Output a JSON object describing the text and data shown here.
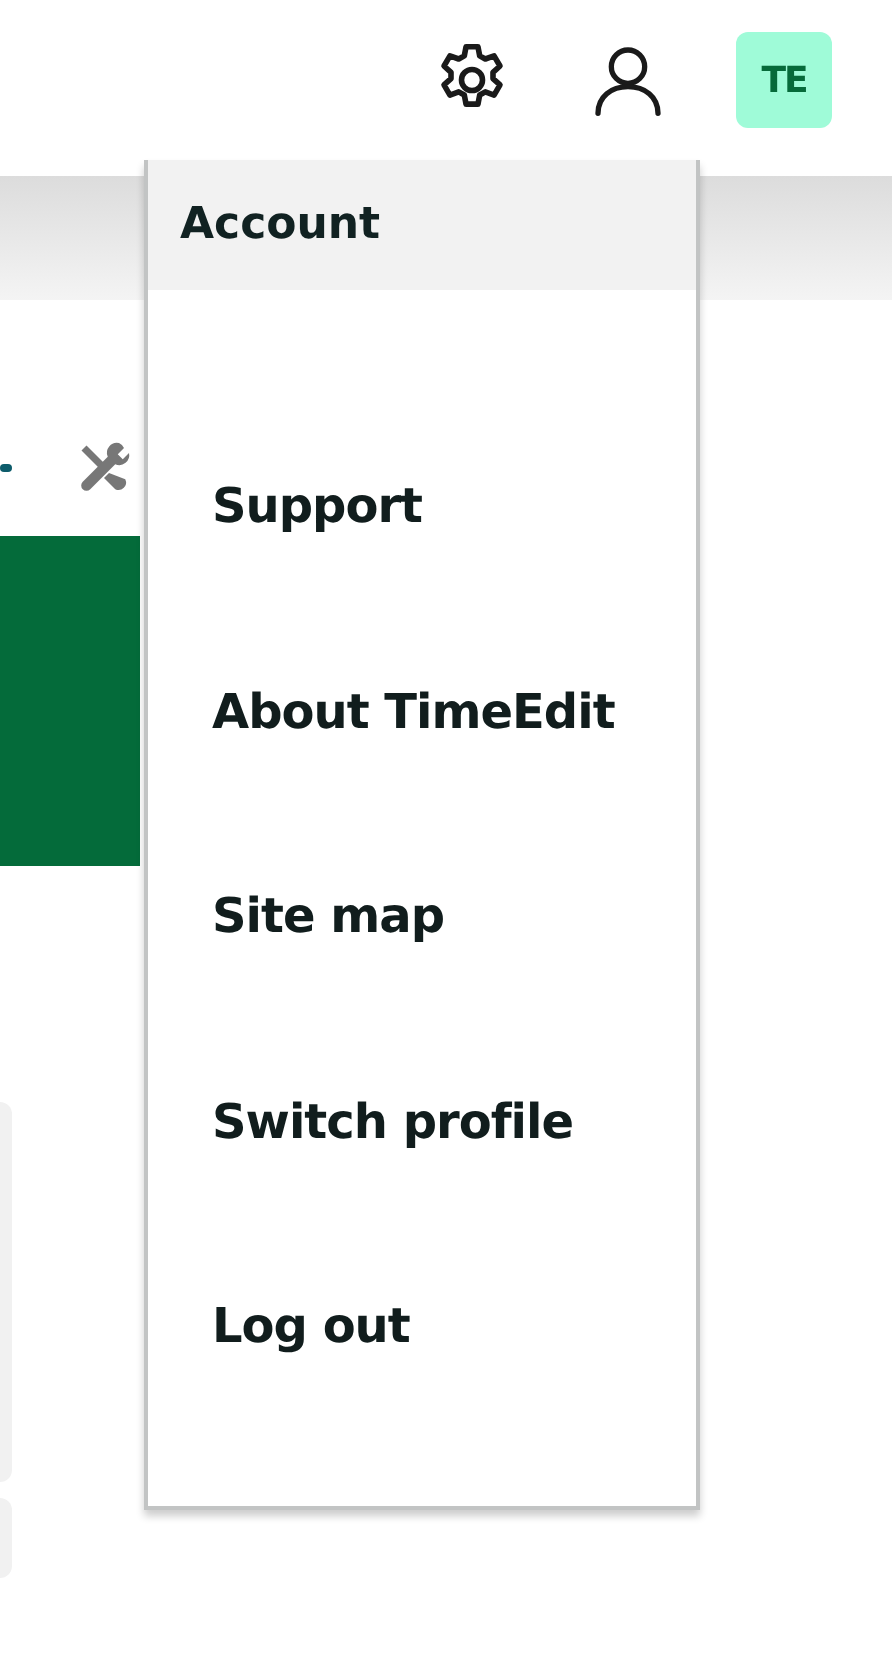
{
  "header": {
    "logo_text": "TE"
  },
  "account_menu": {
    "title": "Account",
    "expanded": true,
    "items": [
      {
        "label": "Support"
      },
      {
        "label": "About TimeEdit"
      },
      {
        "label": "Site map"
      },
      {
        "label": "Switch profile"
      },
      {
        "label": "Log out"
      }
    ]
  }
}
